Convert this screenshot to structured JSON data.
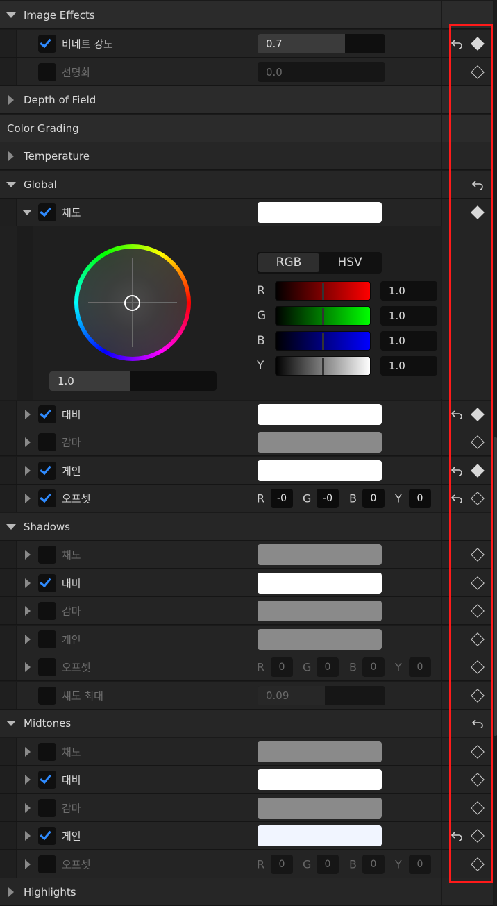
{
  "sections": {
    "image_effects": "Image Effects",
    "depth_of_field": "Depth of Field",
    "color_grading": "Color Grading",
    "temperature": "Temperature",
    "global": "Global",
    "shadows": "Shadows",
    "midtones": "Midtones",
    "highlights": "Highlights"
  },
  "image_effects": {
    "vignette_label": "비네트 강도",
    "vignette_value": "0.7",
    "vignette_fill": 0.7,
    "sharpen_label": "선명화",
    "sharpen_value": "0.0"
  },
  "global": {
    "saturation_label": "채도",
    "contrast_label": "대비",
    "gamma_label": "감마",
    "gain_label": "게인",
    "offset_label": "오프셋",
    "picker": {
      "wheel_value": "1.0",
      "tab_rgb": "RGB",
      "tab_hsv": "HSV",
      "channels": [
        {
          "name": "R",
          "value": "1.0"
        },
        {
          "name": "G",
          "value": "1.0"
        },
        {
          "name": "B",
          "value": "1.0"
        },
        {
          "name": "Y",
          "value": "1.0"
        }
      ]
    },
    "offset_values": {
      "r": "-0",
      "g": "-0",
      "b": "0",
      "y": "0"
    }
  },
  "shadows": {
    "saturation_label": "채도",
    "contrast_label": "대비",
    "gamma_label": "감마",
    "gain_label": "게인",
    "offset_label": "오프셋",
    "max_label": "섀도 최대",
    "max_value": "0.09",
    "offset_values": {
      "r": "0",
      "g": "0",
      "b": "0",
      "y": "0"
    }
  },
  "midtones": {
    "saturation_label": "채도",
    "contrast_label": "대비",
    "gamma_label": "감마",
    "gain_label": "게인",
    "offset_label": "오프셋",
    "offset_values": {
      "r": "0",
      "g": "0",
      "b": "0",
      "y": "0"
    }
  },
  "channel_letters": {
    "r": "R",
    "g": "G",
    "b": "B",
    "y": "Y"
  },
  "colors": {
    "check": "#2f8bff",
    "highlight_box": "#ff1a1a"
  }
}
